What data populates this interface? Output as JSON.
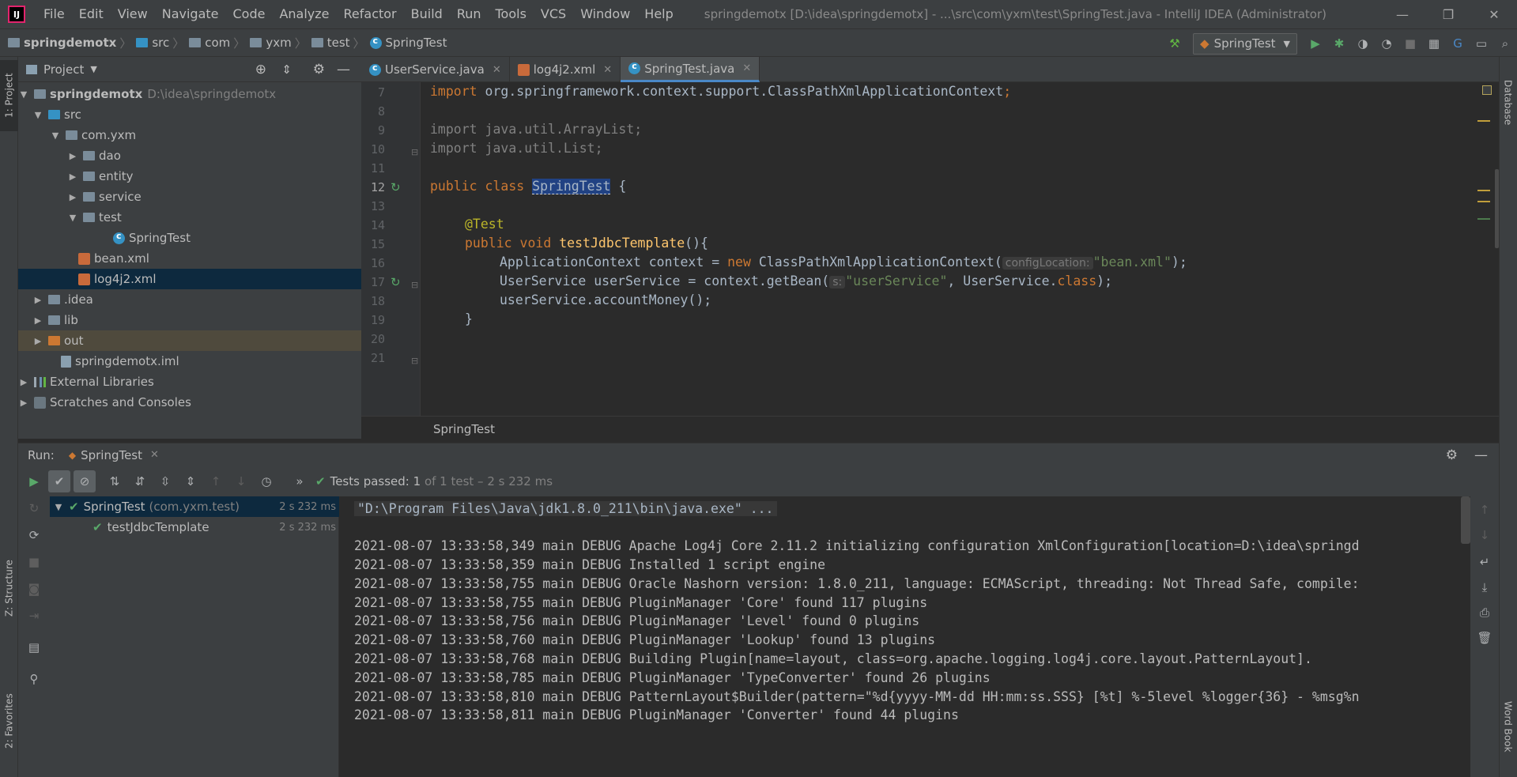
{
  "app": {
    "logo": "IJ",
    "window_title": "springdemotx [D:\\idea\\springdemotx] - ...\\src\\com\\yxm\\test\\SpringTest.java - IntelliJ IDEA (Administrator)"
  },
  "menu": [
    "File",
    "Edit",
    "View",
    "Navigate",
    "Code",
    "Analyze",
    "Refactor",
    "Build",
    "Run",
    "Tools",
    "VCS",
    "Window",
    "Help"
  ],
  "breadcrumbs": [
    "springdemotx",
    "src",
    "com",
    "yxm",
    "test",
    "SpringTest"
  ],
  "run_config": "SpringTest",
  "left_stripe": {
    "project_tab": "1: Project",
    "structure_tab": "Z: Structure",
    "favorites_tab": "2: Favorites"
  },
  "right_stripe": {
    "database_tab": "Database",
    "wordbook_tab": "Word Book"
  },
  "project_panel": {
    "title": "Project",
    "tree": [
      {
        "label": "springdemotx",
        "hint": "D:\\idea\\springdemotx"
      },
      {
        "label": "src"
      },
      {
        "label": "com.yxm"
      },
      {
        "label": "dao"
      },
      {
        "label": "entity"
      },
      {
        "label": "service"
      },
      {
        "label": "test"
      },
      {
        "label": "SpringTest"
      },
      {
        "label": "bean.xml"
      },
      {
        "label": "log4j2.xml"
      },
      {
        "label": ".idea"
      },
      {
        "label": "lib"
      },
      {
        "label": "out"
      },
      {
        "label": "springdemotx.iml"
      },
      {
        "label": "External Libraries"
      },
      {
        "label": "Scratches and Consoles"
      }
    ]
  },
  "editor_tabs": [
    {
      "label": "UserService.java",
      "icon": "class-icon"
    },
    {
      "label": "log4j2.xml",
      "icon": "xml-icon"
    },
    {
      "label": "SpringTest.java",
      "icon": "class-icon",
      "active": true
    }
  ],
  "line_numbers": [
    "7",
    "8",
    "9",
    "10",
    "11",
    "12",
    "13",
    "14",
    "15",
    "16",
    "17",
    "18",
    "19",
    "20",
    "21"
  ],
  "code": {
    "l7_kw": "import",
    "l7_rest": " org.springframework.context.support.ClassPathXmlApplicationContext",
    "l7_semi": ";",
    "l9": "import java.util.ArrayList;",
    "l10": "import java.util.List;",
    "l12_kw": "public class ",
    "l12_name": "SpringTest",
    "l12_rest": " {",
    "l14": "@Test",
    "l15_kw": "public void ",
    "l15_fn": "testJdbcTemplate",
    "l15_rest": "(){",
    "l16_a": "ApplicationContext context = ",
    "l16_new": "new",
    "l16_b": " ClassPathXmlApplicationContext(",
    "l16_hint": "configLocation:",
    "l16_str": "\"bean.xml\"",
    "l16_end": ");",
    "l17_a": "UserService userService = context.getBean(",
    "l17_hint": "s:",
    "l17_str": "\"userService\"",
    "l17_b": ", UserService.",
    "l17_kw": "class",
    "l17_end": ");",
    "l18": "userService.accountMoney();",
    "l19": "}"
  },
  "editor_breadcrumb": "SpringTest",
  "run_panel": {
    "label": "Run:",
    "tab": "SpringTest",
    "status_check": "✔",
    "status_text": "Tests passed: ",
    "status_count": "1",
    "status_detail": " of 1 test – 2 s 232 ms",
    "tests": [
      {
        "name": "SpringTest",
        "pkg": "(com.yxm.test)",
        "time": "2 s 232 ms"
      },
      {
        "name": "testJdbcTemplate",
        "time": "2 s 232 ms"
      }
    ]
  },
  "console": [
    "\"D:\\Program Files\\Java\\jdk1.8.0_211\\bin\\java.exe\" ...",
    "2021-08-07 13:33:58,349 main DEBUG Apache Log4j Core 2.11.2 initializing configuration XmlConfiguration[location=D:\\idea\\springd",
    "2021-08-07 13:33:58,359 main DEBUG Installed 1 script engine",
    "2021-08-07 13:33:58,755 main DEBUG Oracle Nashorn version: 1.8.0_211, language: ECMAScript, threading: Not Thread Safe, compile:",
    "2021-08-07 13:33:58,755 main DEBUG PluginManager 'Core' found 117 plugins",
    "2021-08-07 13:33:58,756 main DEBUG PluginManager 'Level' found 0 plugins",
    "2021-08-07 13:33:58,760 main DEBUG PluginManager 'Lookup' found 13 plugins",
    "2021-08-07 13:33:58,768 main DEBUG Building Plugin[name=layout, class=org.apache.logging.log4j.core.layout.PatternLayout].",
    "2021-08-07 13:33:58,785 main DEBUG PluginManager 'TypeConverter' found 26 plugins",
    "2021-08-07 13:33:58,810 main DEBUG PatternLayout$Builder(pattern=\"%d{yyyy-MM-dd HH:mm:ss.SSS} [%t] %-5level %logger{36} - %msg%n",
    "2021-08-07 13:33:58,811 main DEBUG PluginManager 'Converter' found 44 plugins"
  ],
  "colors": {
    "keyword": "#cc7832",
    "function": "#ffc66d",
    "string": "#6a8759",
    "annotation": "#bbb529",
    "pass_green": "#59a869",
    "selection": "#0d293e"
  }
}
